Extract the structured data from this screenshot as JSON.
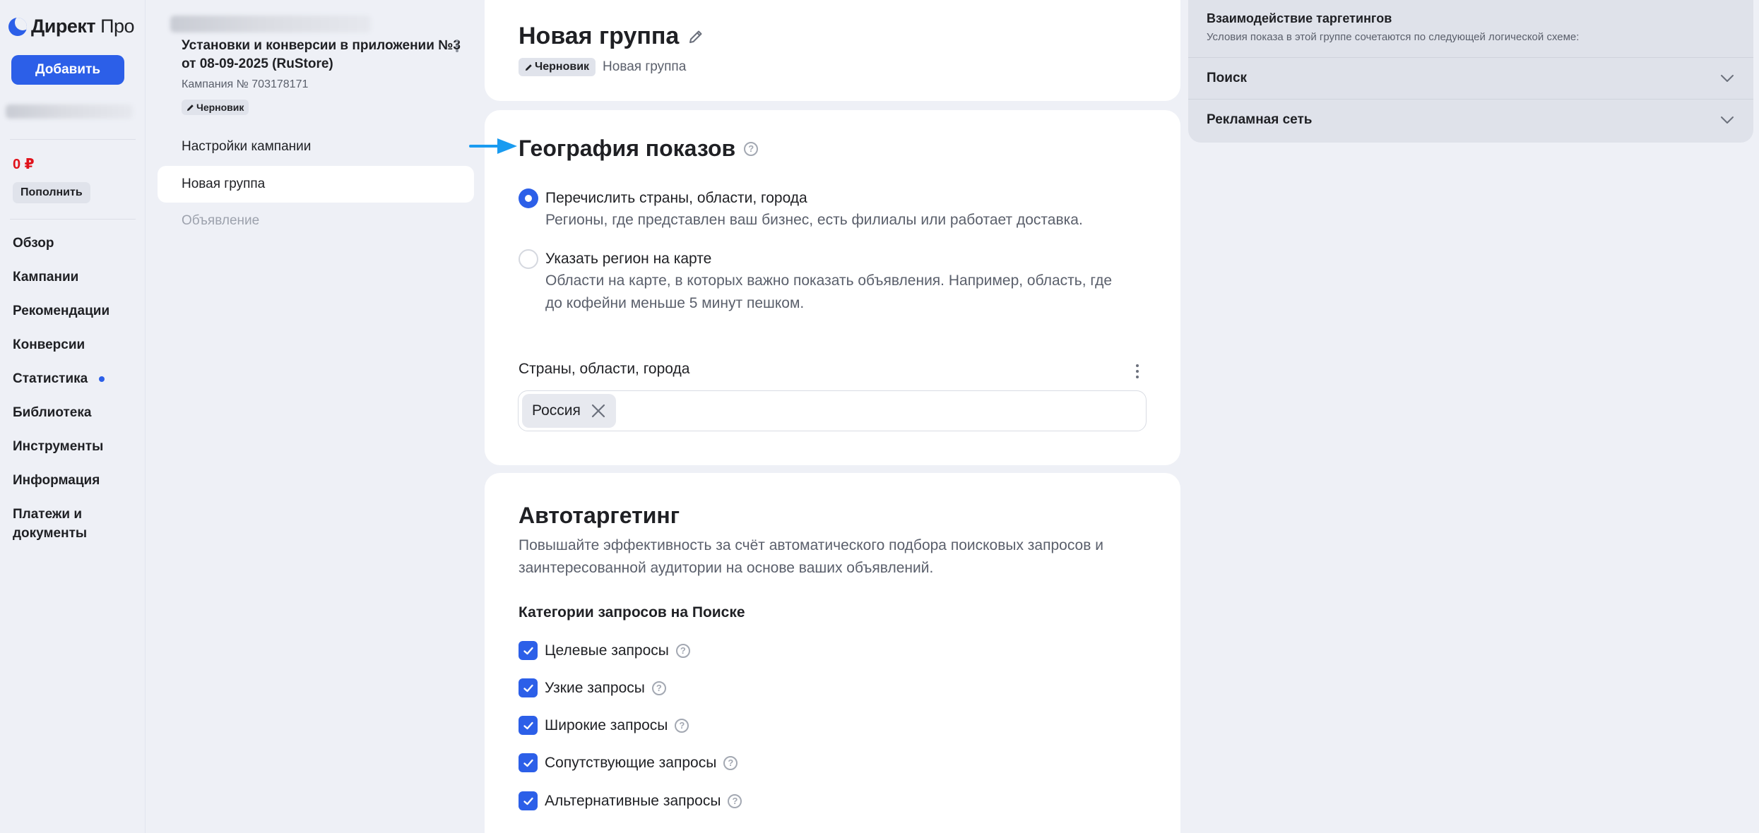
{
  "nav": {
    "logo_direkt": "Директ",
    "logo_pro": "Про",
    "add_label": "Добавить",
    "balance": "0 ₽",
    "topup_label": "Пополнить",
    "items": [
      {
        "label": "Обзор"
      },
      {
        "label": "Кампании"
      },
      {
        "label": "Рекомендации"
      },
      {
        "label": "Конверсии"
      },
      {
        "label": "Статистика",
        "dot": true
      },
      {
        "label": "Библиотека"
      },
      {
        "label": "Инструменты"
      },
      {
        "label": "Информация"
      },
      {
        "label": "Платежи и документы"
      }
    ]
  },
  "campaign": {
    "title": "Установки и конверсии в приложении №3 от 08-09-2025 (RuStore)",
    "number": "Кампания № 703178171",
    "status": "Черновик",
    "items": [
      {
        "label": "Настройки кампании"
      },
      {
        "label": "Новая группа"
      },
      {
        "label": "Объявление"
      }
    ]
  },
  "group": {
    "title": "Новая группа",
    "status": "Черновик",
    "breadcrumb": "Новая группа"
  },
  "geo": {
    "title": "География показов",
    "options": [
      {
        "title": "Перечислить страны, области, города",
        "desc": "Регионы, где представлен ваш бизнес, есть филиалы или работает доставка.",
        "selected": true
      },
      {
        "title": "Указать регион на карте",
        "desc": "Области на карте, в которых важно показать объявления. Например, область, где до кофейни меньше 5 минут пешком.",
        "selected": false
      }
    ],
    "field_label": "Страны, области, города",
    "tags": [
      {
        "label": "Россия"
      }
    ]
  },
  "autotarget": {
    "title": "Автотаргетинг",
    "desc": "Повышайте эффективность за счёт автоматического подбора поисковых запросов и заинтересованной аудитории на основе ваших объявлений.",
    "categories_title": "Категории запросов на Поиске",
    "categories": [
      {
        "label": "Целевые запросы",
        "checked": true
      },
      {
        "label": "Узкие запросы",
        "checked": true
      },
      {
        "label": "Широкие запросы",
        "checked": true
      },
      {
        "label": "Сопутствующие запросы",
        "checked": true
      },
      {
        "label": "Альтернативные запросы",
        "checked": true
      }
    ]
  },
  "targeting_panel": {
    "title": "Взаимодействие таргетингов",
    "subtitle": "Условия показа в этой группе сочетаются по следующей логической схеме:",
    "rows": [
      {
        "label": "Поиск"
      },
      {
        "label": "Рекламная сеть"
      }
    ]
  },
  "colors": {
    "accent": "#2c5fe8",
    "balance": "#e0121b",
    "arrow": "#1a9bf0"
  }
}
